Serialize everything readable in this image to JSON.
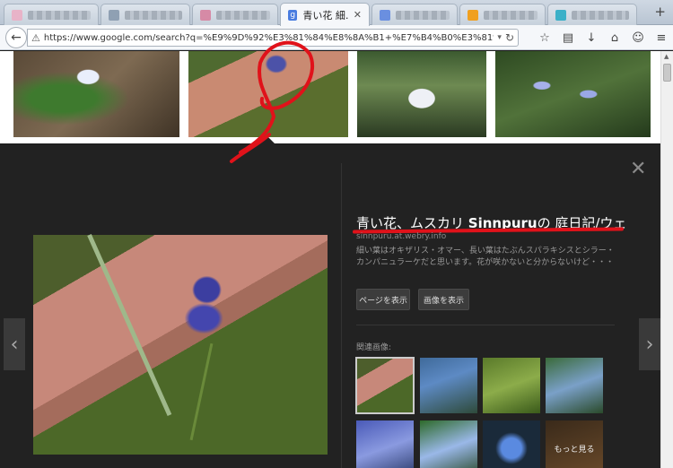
{
  "browser": {
    "active_tab": {
      "title": "青い花 細…"
    },
    "new_tab_label": "+",
    "url": "https://www.google.com/search?q=%E9%9D%92%E3%81%84%E8%8A%B1+%E7%B4%B0%E3%81%84%E8%91%89+&tbm="
  },
  "detail": {
    "title_prefix": "青い花、ムスカリ ",
    "title_bold": "Sinnpuru",
    "title_suffix": "の 庭日記/ウェ…",
    "source": "sinnpuru.at.webry.info",
    "description": "細い葉はオキザリス・オマー、長い葉はたぶんスパラキシスとシラー・カンパニュラーケだと思います。花が咲かないと分からないけど・・・",
    "visit_button": "ページを表示",
    "view_image_button": "画像を表示",
    "related_label": "関連画像:",
    "more_label": "もっと見る"
  },
  "colors": {
    "annotation": "#e0121a",
    "panel": "#222222"
  },
  "icons": [
    "back-arrow-icon",
    "warning-icon",
    "reload-icon",
    "star-icon",
    "reading-list-icon",
    "download-icon",
    "home-icon",
    "chat-icon",
    "menu-icon",
    "close-icon",
    "chevron-left-icon",
    "chevron-right-icon"
  ]
}
